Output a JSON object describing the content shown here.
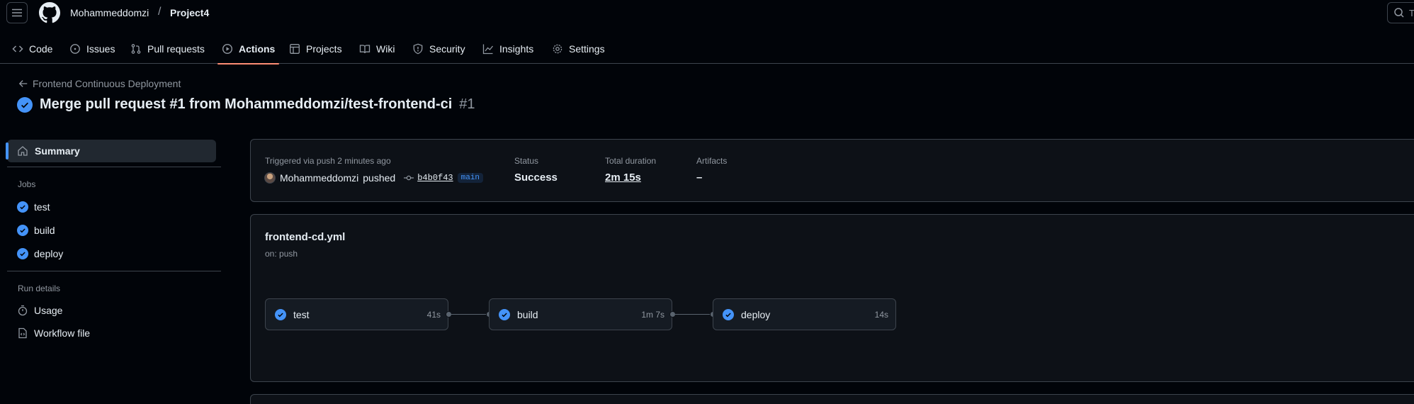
{
  "header": {
    "owner": "Mohammeddomzi",
    "separator": "/",
    "repo": "Project4",
    "search_hint": "T"
  },
  "nav": {
    "items": [
      {
        "label": "Code",
        "icon": "code-icon"
      },
      {
        "label": "Issues",
        "icon": "issue-icon"
      },
      {
        "label": "Pull requests",
        "icon": "pull-request-icon"
      },
      {
        "label": "Actions",
        "icon": "play-icon",
        "active": true
      },
      {
        "label": "Projects",
        "icon": "table-icon"
      },
      {
        "label": "Wiki",
        "icon": "book-icon"
      },
      {
        "label": "Security",
        "icon": "shield-icon"
      },
      {
        "label": "Insights",
        "icon": "graph-icon"
      },
      {
        "label": "Settings",
        "icon": "gear-icon"
      }
    ]
  },
  "run": {
    "back_label": "Frontend Continuous Deployment",
    "title": "Merge pull request #1 from Mohammeddomzi/test-frontend-ci",
    "number": "#1"
  },
  "sidebar": {
    "summary": "Summary",
    "jobs_heading": "Jobs",
    "jobs": [
      "test",
      "build",
      "deploy"
    ],
    "run_details_heading": "Run details",
    "usage": "Usage",
    "workflow_file": "Workflow file"
  },
  "summary": {
    "trigger": "Triggered via push 2 minutes ago",
    "actor": "Mohammeddomzi",
    "action": "pushed",
    "commit": "b4b0f43",
    "branch": "main",
    "status_label": "Status",
    "status_value": "Success",
    "duration_label": "Total duration",
    "duration_value": "2m 15s",
    "artifacts_label": "Artifacts",
    "artifacts_value": "–"
  },
  "workflow": {
    "file": "frontend-cd.yml",
    "trigger": "on: push",
    "jobs": [
      {
        "name": "test",
        "duration": "41s"
      },
      {
        "name": "build",
        "duration": "1m 7s"
      },
      {
        "name": "deploy",
        "duration": "14s"
      }
    ]
  },
  "colors": {
    "background": "#010409",
    "accent": "#4493f8",
    "active_tab": "#fd8c73",
    "border": "#3d444d"
  }
}
